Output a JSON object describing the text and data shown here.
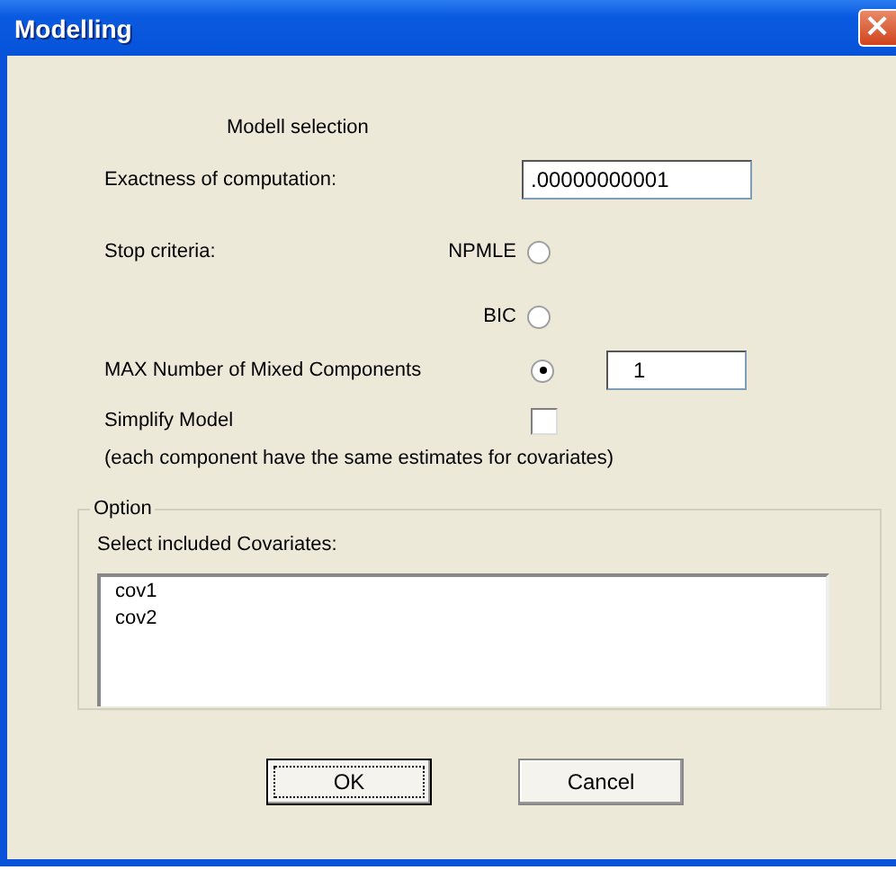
{
  "window": {
    "title": "Modelling",
    "close": "×"
  },
  "heading": "Modell selection",
  "exactness": {
    "label": "Exactness of computation:",
    "value": ".00000000001"
  },
  "stop_criteria": {
    "label": "Stop criteria:",
    "options": [
      {
        "label": "NPMLE",
        "selected": false
      },
      {
        "label": "BIC",
        "selected": false
      },
      {
        "label": "MAX Number of Mixed Components",
        "selected": true,
        "value": "1"
      }
    ]
  },
  "simplify": {
    "label": "Simplify Model",
    "checked": false,
    "note": "(each component have the same estimates for covariates)"
  },
  "option_group": {
    "title": "Option",
    "list_label": "Select included Covariates:",
    "items": [
      {
        "label": "cov1",
        "selected": false
      },
      {
        "label": "cov2",
        "selected": false
      }
    ]
  },
  "buttons": [
    {
      "label": "OK",
      "default": true
    },
    {
      "label": "Cancel",
      "default": false
    }
  ]
}
